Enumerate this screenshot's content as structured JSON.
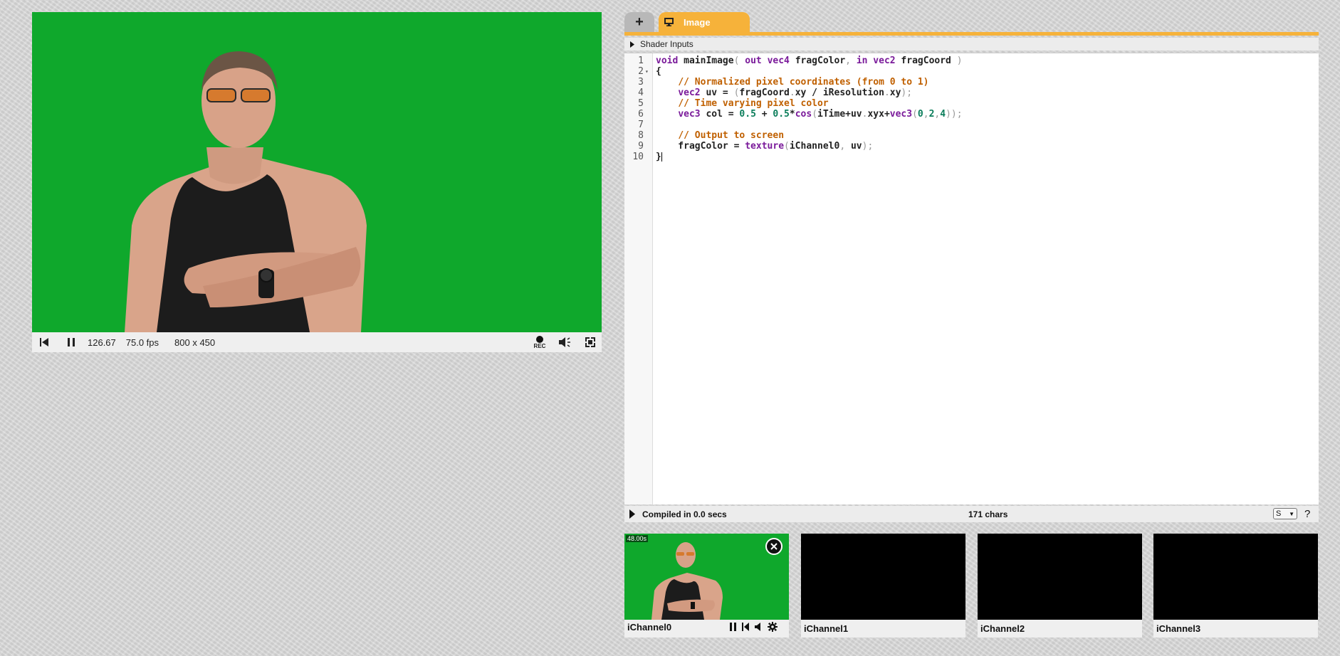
{
  "player": {
    "time": "126.67",
    "fps": "75.0 fps",
    "resolution": "800 x 450",
    "rec_label": "REC",
    "icons": [
      "rewind-icon",
      "pause-icon",
      "record-icon",
      "volume-icon",
      "fullscreen-icon"
    ]
  },
  "editor": {
    "tab_add_label": "+",
    "tab_image_label": "Image",
    "shader_inputs_label": "Shader Inputs",
    "line_numbers": [
      "1",
      "2",
      "3",
      "4",
      "5",
      "6",
      "7",
      "8",
      "9",
      "10"
    ],
    "code_lines": [
      "void mainImage( out vec4 fragColor, in vec2 fragCoord )",
      "{",
      "    // Normalized pixel coordinates (from 0 to 1)",
      "    vec2 uv = (fragCoord.xy / iResolution.xy);",
      "    // Time varying pixel color",
      "    vec3 col = 0.5 + 0.5*cos(iTime+uv.xyx+vec3(0,2,4));",
      "",
      "    // Output to screen",
      "    fragColor = texture(iChannel0, uv);",
      "}"
    ],
    "compile_status": "Compiled in 0.0 secs",
    "char_count": "171 chars",
    "mode_select_value": "S",
    "help_label": "?"
  },
  "channels": [
    {
      "label": "iChannel0",
      "badge": "48.00s",
      "has_video": true
    },
    {
      "label": "iChannel1",
      "has_video": false
    },
    {
      "label": "iChannel2",
      "has_video": false
    },
    {
      "label": "iChannel3",
      "has_video": false
    }
  ],
  "colors": {
    "accent": "#f6b23a",
    "greenscreen": "#0fa82c",
    "keyword": "#7a1a9a",
    "comment": "#c06000",
    "number": "#0a7d5a"
  }
}
